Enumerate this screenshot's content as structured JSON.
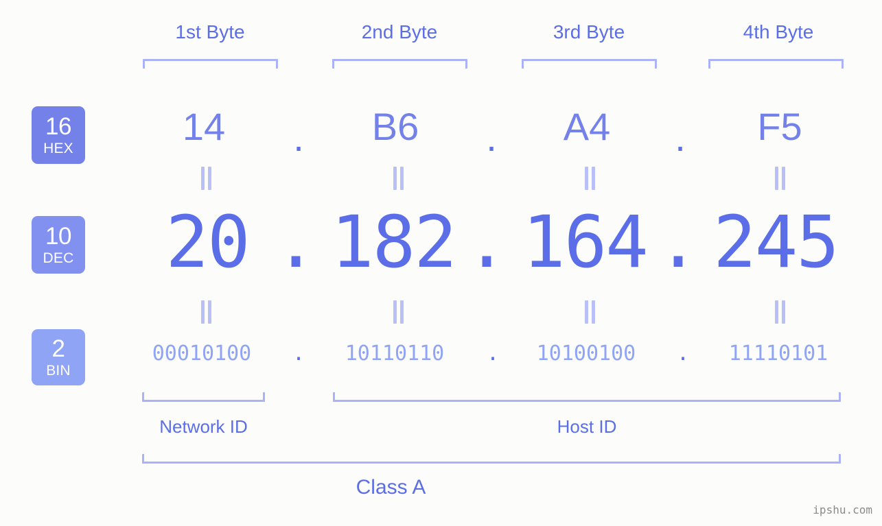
{
  "background_color": "#fcfdfa",
  "accent_color": "#5b6ee8",
  "bracket_color": "#aab3f7",
  "byte_headers": [
    {
      "label": "1st Byte"
    },
    {
      "label": "2nd Byte"
    },
    {
      "label": "3rd Byte"
    },
    {
      "label": "4th Byte"
    }
  ],
  "bases": [
    {
      "number": "16",
      "name": "HEX",
      "color": "#7381e8"
    },
    {
      "number": "10",
      "name": "DEC",
      "color": "#8290f0"
    },
    {
      "number": "2",
      "name": "BIN",
      "color": "#8fa4f5"
    }
  ],
  "rows": {
    "hex": {
      "base_number": "16",
      "base_name": "HEX",
      "separator": ".",
      "octets": [
        "14",
        "B6",
        "A4",
        "F5"
      ],
      "full": "14.B6.A4.F5"
    },
    "dec": {
      "base_number": "10",
      "base_name": "DEC",
      "separator": ".",
      "octets": [
        "20",
        "182",
        "164",
        "245"
      ],
      "full": "20.182.164.245"
    },
    "bin": {
      "base_number": "2",
      "base_name": "BIN",
      "separator": ".",
      "octets": [
        "00010100",
        "10110110",
        "10100100",
        "11110101"
      ],
      "full": "00010100.10110110.10100100.11110101"
    }
  },
  "equality_marks": [
    "=",
    "=",
    "=",
    "=",
    "=",
    "=",
    "=",
    "="
  ],
  "partition": {
    "network_id_label": "Network ID",
    "host_id_label": "Host ID"
  },
  "class_label": "Class A",
  "watermark": "ipshu.com"
}
